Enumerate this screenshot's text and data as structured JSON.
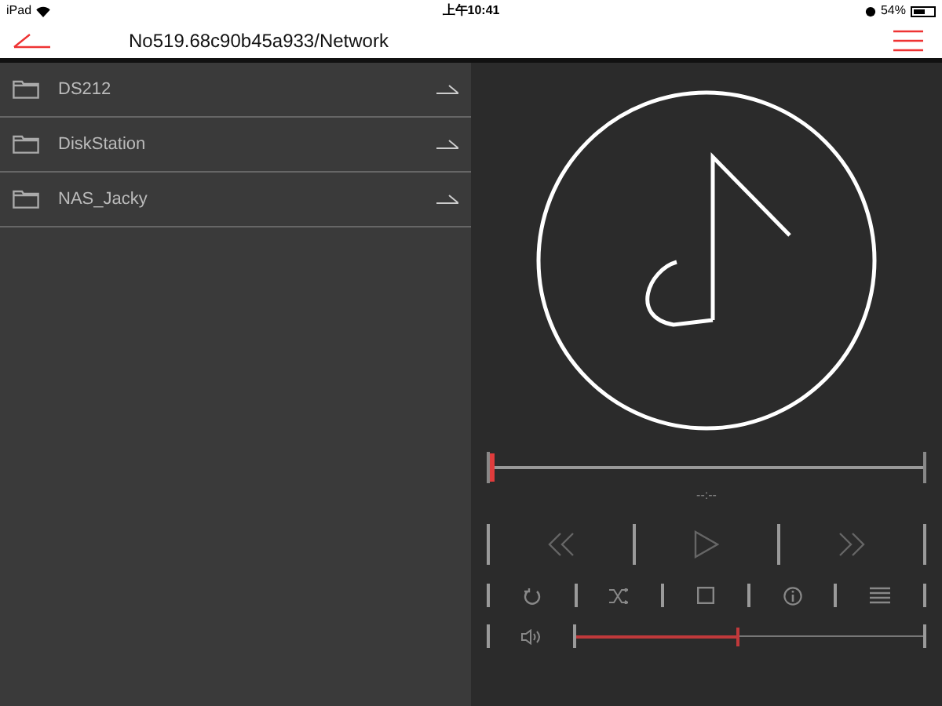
{
  "status_bar": {
    "device": "iPad",
    "time": "上午10:41",
    "battery": "54%"
  },
  "header": {
    "title": "No519.68c90b45a933/Network"
  },
  "items": [
    {
      "label": "DS212"
    },
    {
      "label": "DiskStation"
    },
    {
      "label": "NAS_Jacky"
    }
  ],
  "player": {
    "progress": {
      "level": 0
    },
    "time": "--:--",
    "volume": {
      "level": 0.46
    }
  }
}
